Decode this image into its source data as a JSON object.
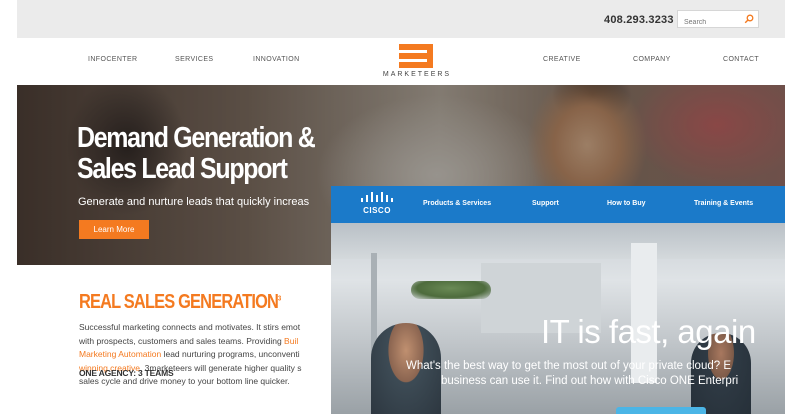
{
  "marketeers": {
    "topbar": {
      "phone": "408.293.3233",
      "search_placeholder": "Search"
    },
    "nav": {
      "left_items": [
        "INFOCENTER",
        "SERVICES",
        "INNOVATION"
      ],
      "right_items": [
        "CREATIVE",
        "COMPANY",
        "CONTACT"
      ],
      "logo_text": "MARKETEERS"
    },
    "hero": {
      "title_line1": "Demand Generation &",
      "title_line2": "Sales Lead Support",
      "subtitle": "Generate and nurture leads that quickly increas",
      "button_label": "Learn More"
    },
    "section": {
      "title": "REAL SALES GENERATION",
      "title_sup": "3",
      "para_1": "Successful marketing connects and motivates. It stirs emot",
      "para_2": "with prospects, customers and sales teams. Providing ",
      "para_2_link": "Buil",
      "para_3_link": "Marketing Automation",
      "para_3": " lead nurturing programs, unconventi",
      "para_4_link": "winning creative",
      "para_4": ", 3marketeers will generate higher quality s",
      "para_5": "sales cycle and drive money to your bottom line quicker.",
      "agency_heading": "ONE AGENCY: 3 TEAMS"
    },
    "colors": {
      "accent": "#f47a20"
    }
  },
  "cisco": {
    "logo_text": "CISCO",
    "nav_items": [
      "Products & Services",
      "Support",
      "How to Buy",
      "Training & Events"
    ],
    "hero": {
      "headline": "IT is fast, again",
      "subline_1": "What's the best way to get the most out of your private cloud? E",
      "subline_2": "business can use it. Find out how with Cisco ONE Enterpri"
    },
    "colors": {
      "nav_bg": "#1b7ac9",
      "cta": "#4bb5e6"
    }
  }
}
